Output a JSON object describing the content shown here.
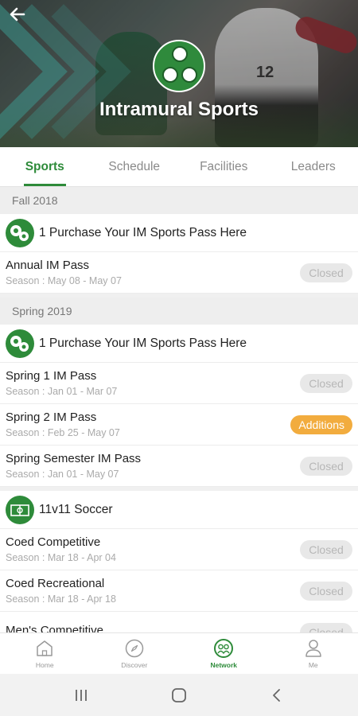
{
  "header": {
    "title": "Intramural Sports",
    "back_icon": "arrow-left-icon",
    "logo_icon": "sports-balls-logo-icon"
  },
  "tabs": [
    {
      "label": "Sports",
      "active": true
    },
    {
      "label": "Schedule",
      "active": false
    },
    {
      "label": "Facilities",
      "active": false
    },
    {
      "label": "Leaders",
      "active": false
    }
  ],
  "sections": [
    {
      "header": "Fall 2018",
      "groups": [
        {
          "icon": "sports-balls-icon",
          "title": "1 Purchase Your IM Sports Pass Here",
          "items": [
            {
              "name": "Annual IM Pass",
              "season": "Season : May 08 - May 07",
              "status": "Closed"
            }
          ]
        }
      ]
    },
    {
      "header": "Spring 2019",
      "groups": [
        {
          "icon": "sports-balls-icon",
          "title": "1 Purchase Your IM Sports Pass Here",
          "items": [
            {
              "name": "Spring 1 IM Pass",
              "season": "Season : Jan 01 - Mar 07",
              "status": "Closed"
            },
            {
              "name": "Spring 2 IM Pass",
              "season": "Season : Feb 25 - May 07",
              "status": "Additions"
            },
            {
              "name": "Spring Semester IM Pass",
              "season": "Season : Jan 01 - May 07",
              "status": "Closed"
            }
          ]
        },
        {
          "icon": "soccer-icon",
          "title": "11v11 Soccer",
          "items": [
            {
              "name": "Coed Competitive",
              "season": "Season : Mar 18 - Apr 04",
              "status": "Closed"
            },
            {
              "name": "Coed Recreational",
              "season": "Season : Mar 18 - Apr 18",
              "status": "Closed"
            },
            {
              "name": "Men's Competitive",
              "season": "",
              "status": "Closed"
            }
          ]
        }
      ]
    }
  ],
  "bottom_nav": [
    {
      "label": "Home",
      "icon": "home-icon",
      "active": false
    },
    {
      "label": "Discover",
      "icon": "compass-icon",
      "active": false
    },
    {
      "label": "Network",
      "icon": "network-icon",
      "active": true
    },
    {
      "label": "Me",
      "icon": "person-icon",
      "active": false
    }
  ],
  "system_nav": {
    "recents": "recents-icon",
    "home": "home-circle-icon",
    "back": "back-chevron-icon"
  },
  "colors": {
    "accent": "#2e8b3a",
    "warning": "#f2ac3e",
    "closed_bg": "#e8e8e8"
  }
}
